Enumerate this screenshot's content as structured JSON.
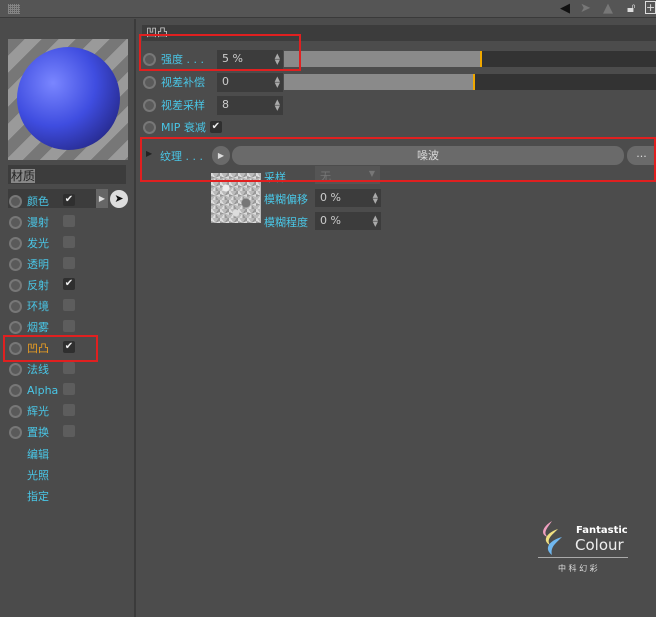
{
  "toolbar": {
    "icons": [
      "grip-icon",
      "back-arrow-icon",
      "forward-arrow-icon",
      "up-arrow-icon",
      "lock-icon",
      "new-panel-icon"
    ]
  },
  "material": {
    "name": "材质"
  },
  "channels": [
    {
      "label": "颜色",
      "checked": true
    },
    {
      "label": "漫射",
      "checked": false
    },
    {
      "label": "发光",
      "checked": false
    },
    {
      "label": "透明",
      "checked": false
    },
    {
      "label": "反射",
      "checked": true
    },
    {
      "label": "环境",
      "checked": false
    },
    {
      "label": "烟雾",
      "checked": false
    },
    {
      "label": "凹凸",
      "checked": true,
      "active": true
    },
    {
      "label": "法线",
      "checked": false
    },
    {
      "label": "Alpha",
      "checked": false
    },
    {
      "label": "辉光",
      "checked": false
    },
    {
      "label": "置换",
      "checked": false
    }
  ],
  "extra_items": [
    "编辑",
    "光照",
    "指定"
  ],
  "check_mark": "✔",
  "section": {
    "title": "凹凸"
  },
  "params": {
    "strength": {
      "label": "强度 . . .",
      "value": "5 %",
      "fill": 0.52
    },
    "parallax_offset": {
      "label": "视差补偿",
      "value": "0",
      "fill": 0.5
    },
    "parallax_samples": {
      "label": "视差采样",
      "value": "8"
    },
    "mip": {
      "label": "MIP 衰减",
      "checked": true
    }
  },
  "texture": {
    "label": "纹理 . . .",
    "shader": "噪波",
    "more": "...",
    "sampling_label": "采样",
    "sampling_value": "无",
    "blur_offset_label": "模糊偏移",
    "blur_offset_value": "0 %",
    "blur_scale_label": "模糊程度",
    "blur_scale_value": "0 %"
  },
  "logo": {
    "line1": "Fantastic",
    "line2": "Colour",
    "line3": "中 科 幻 彩"
  },
  "colors": {
    "accent": "#49c6e6",
    "active": "#f0a020",
    "highlight": "#e02020",
    "marker": "#f0a800"
  }
}
